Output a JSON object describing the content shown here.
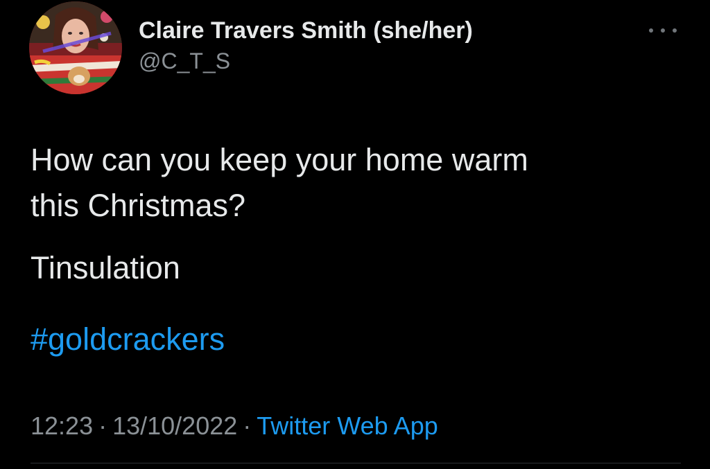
{
  "author": {
    "display_name": "Claire Travers Smith (she/her)",
    "handle": "@C_T_S",
    "avatar_alt": "profile-photo"
  },
  "more_icon": "more-horizontal-icon",
  "tweet": {
    "line1": "How can you keep your home warm",
    "line2": "this Christmas?",
    "line3": "Tinsulation",
    "hashtag": "#goldcrackers"
  },
  "meta": {
    "time": "12:23",
    "separator": "·",
    "date": "13/10/2022",
    "source": "Twitter Web App"
  },
  "colors": {
    "background": "#000000",
    "text": "#e7e9ea",
    "secondary": "#8b9196",
    "link": "#1d9bf0"
  }
}
